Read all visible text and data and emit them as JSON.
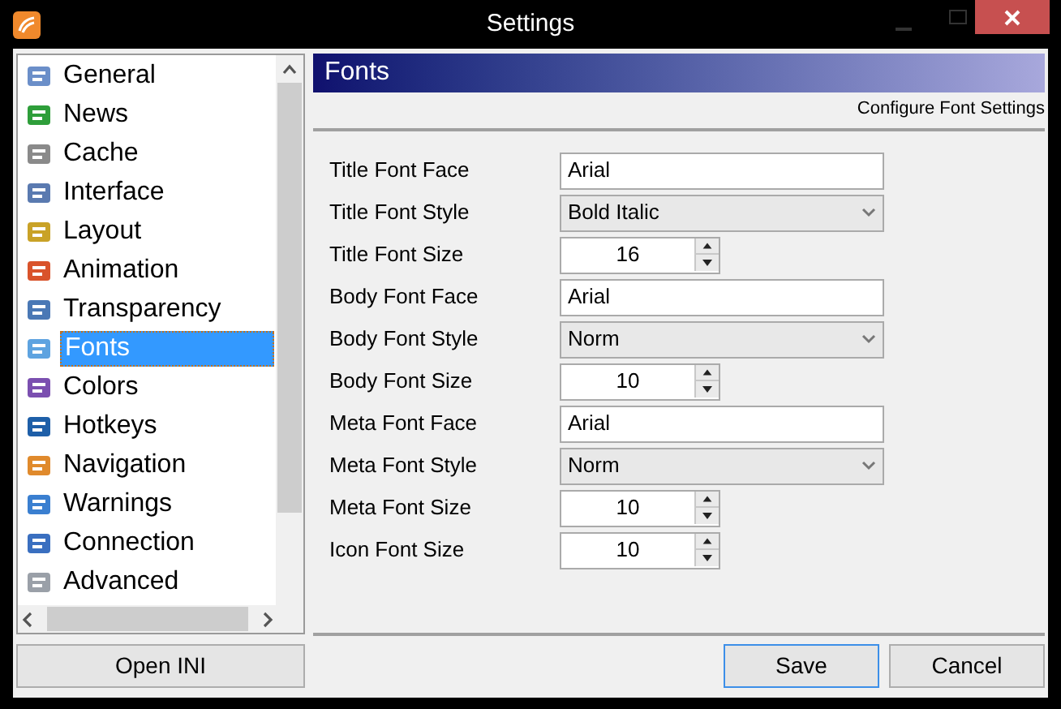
{
  "window": {
    "title": "Settings"
  },
  "sidebar": {
    "items": [
      {
        "label": "General",
        "selected": false
      },
      {
        "label": "News",
        "selected": false
      },
      {
        "label": "Cache",
        "selected": false
      },
      {
        "label": "Interface",
        "selected": false
      },
      {
        "label": "Layout",
        "selected": false
      },
      {
        "label": "Animation",
        "selected": false
      },
      {
        "label": "Transparency",
        "selected": false
      },
      {
        "label": "Fonts",
        "selected": true
      },
      {
        "label": "Colors",
        "selected": false
      },
      {
        "label": "Hotkeys",
        "selected": false
      },
      {
        "label": "Navigation",
        "selected": false
      },
      {
        "label": "Warnings",
        "selected": false
      },
      {
        "label": "Connection",
        "selected": false
      },
      {
        "label": "Advanced",
        "selected": false
      }
    ],
    "button": "Open INI"
  },
  "panel": {
    "title": "Fonts",
    "subtitle": "Configure Font Settings",
    "fields": [
      {
        "label": "Title Font Face",
        "kind": "text",
        "value": "Arial"
      },
      {
        "label": "Title Font Style",
        "kind": "select",
        "value": "Bold Italic"
      },
      {
        "label": "Title Font Size",
        "kind": "spin",
        "value": "16"
      },
      {
        "label": "Body Font Face",
        "kind": "text",
        "value": "Arial"
      },
      {
        "label": "Body Font Style",
        "kind": "select",
        "value": "Norm"
      },
      {
        "label": "Body Font Size",
        "kind": "spin",
        "value": "10"
      },
      {
        "label": "Meta Font Face",
        "kind": "text",
        "value": "Arial"
      },
      {
        "label": "Meta Font Style",
        "kind": "select",
        "value": "Norm"
      },
      {
        "label": "Meta Font Size",
        "kind": "spin",
        "value": "10"
      },
      {
        "label": "Icon Font Size",
        "kind": "spin",
        "value": "10"
      }
    ]
  },
  "buttons": [
    {
      "label": "Save",
      "default": true
    },
    {
      "label": "Cancel",
      "default": false
    }
  ]
}
